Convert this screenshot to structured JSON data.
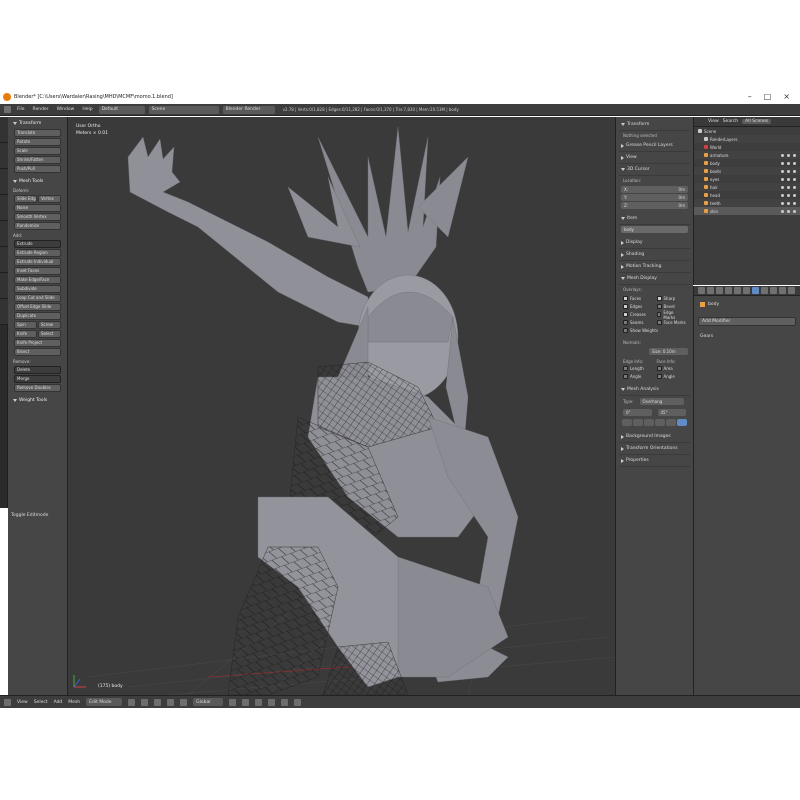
{
  "window": {
    "title": "Blender* [C:\\Users\\Wardaler\\Rasing\\MHD\\MCMF\\momo.1.blend]",
    "controls": [
      "–",
      "□",
      "×"
    ]
  },
  "header": {
    "menus": [
      "File",
      "Render",
      "Window",
      "Help"
    ],
    "layout": "Default",
    "scene": "Scene",
    "engine": "Blender Render",
    "stats": "v2.78 | Verts:0/1,828 | Edges:0/11,282 | Faces:0/1,370 | Tris:7,830 | Mem:20.53M | body"
  },
  "toolshelf": {
    "transform_hdr": "Transform",
    "transform": [
      "Translate",
      "Rotate",
      "Scale",
      "Shrink/Fatten",
      "Push/Pull"
    ],
    "meshtools_hdr": "Mesh Tools",
    "deform_lbl": "Deform:",
    "slide": [
      "Slide Edge",
      "Vertex"
    ],
    "deform": [
      "Noise",
      "Smooth Vertex",
      "Randomize"
    ],
    "add_lbl": "Add:",
    "extrude_sel": "Extrude",
    "add": [
      "Extrude Region",
      "Extrude Individual",
      "Inset Faces",
      "Make Edge/Face",
      "Subdivide",
      "Loop Cut and Slide",
      "Offset Edge Slide",
      "Duplicate"
    ],
    "spin": [
      "Spin",
      "Screw"
    ],
    "knife": [
      "Knife",
      "Select"
    ],
    "add2": [
      "Knife Project",
      "Bisect"
    ],
    "remove_lbl": "Remove:",
    "delete_sel": "Delete",
    "merge_sel": "Merge",
    "remove_doubles": "Remove Doubles",
    "weight_hdr": "Weight Tools",
    "toggle_edit": "Toggle Editmode"
  },
  "viewport": {
    "view_name": "User Ortho",
    "unit": "Meters × 0.01",
    "object": "(175) body"
  },
  "npanel": {
    "transform": "Transform",
    "nothing": "Nothing selected",
    "grease": "Grease Pencil Layers",
    "view": "View",
    "cursor": "3D Cursor",
    "location_lbl": "Location:",
    "loc": [
      {
        "axis": "X:",
        "val": "0m"
      },
      {
        "axis": "Y:",
        "val": "0m"
      },
      {
        "axis": "Z:",
        "val": "0m"
      }
    ],
    "item": "Item",
    "item_name": "body",
    "display": "Display",
    "shading": "Shading",
    "motion": "Motion Tracking",
    "mesh_display": "Mesh Display",
    "overlays_lbl": "Overlays:",
    "overlays": [
      {
        "label": "Faces",
        "on": true
      },
      {
        "label": "Sharp",
        "on": true
      },
      {
        "label": "Edges",
        "on": true
      },
      {
        "label": "Bevel",
        "on": false
      },
      {
        "label": "Creases",
        "on": true
      },
      {
        "label": "Edge Marks",
        "on": false
      },
      {
        "label": "Seams",
        "on": false
      },
      {
        "label": "Face Marks",
        "on": false
      }
    ],
    "show_weights": "Show Weights",
    "normals_lbl": "Normals:",
    "normals_size": "Size: 0.10m",
    "edge_info": "Edge Info:",
    "face_info": "Face Info:",
    "info": [
      {
        "label": "Length",
        "on": false
      },
      {
        "label": "Area",
        "on": false
      },
      {
        "label": "Angle",
        "on": false
      },
      {
        "label": "Angle",
        "on": false
      }
    ],
    "analysis": "Mesh Analysis",
    "type_lbl": "Type:",
    "type_val": "Overhang",
    "range": [
      "0°",
      "45°"
    ],
    "bg_images": "Background Images",
    "orientations": "Transform Orientations",
    "properties": "Properties"
  },
  "outliner": {
    "view": "View",
    "search": "Search",
    "scenes": "All Scenes",
    "rows": [
      "Scene",
      "RenderLayers",
      "World",
      "armature",
      "body",
      "boots",
      "eyes",
      "hair",
      "head",
      "teeth",
      "skin"
    ]
  },
  "props": {
    "object": "body",
    "add_modifier": "Add Modifier",
    "gears": "Gears"
  },
  "bottom": {
    "menus": [
      "View",
      "Select",
      "Add",
      "Mesh"
    ],
    "mode": "Edit Mode",
    "pivot": "Global"
  }
}
